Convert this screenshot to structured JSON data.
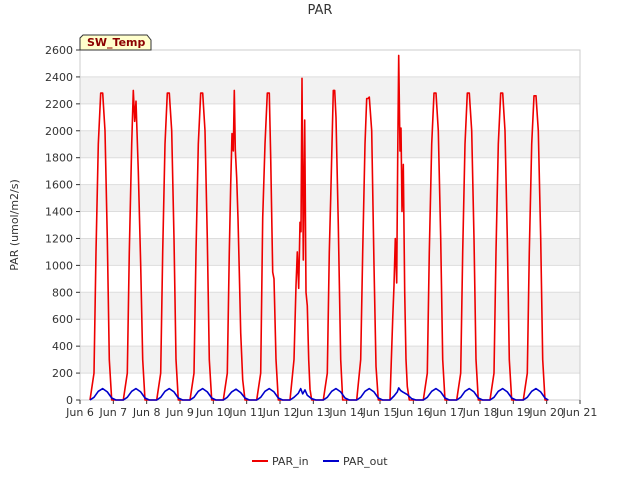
{
  "chart_data": {
    "type": "line",
    "title": "PAR",
    "ylabel": "PAR (umol/m2/s)",
    "xlabel": "",
    "xlim": [
      6,
      21
    ],
    "ylim": [
      0,
      2600
    ],
    "x_ticks": [
      "Jun 6",
      "Jun 7",
      "Jun 8",
      "Jun 9",
      "Jun 10",
      "Jun 11",
      "Jun 12",
      "Jun 13",
      "Jun 14",
      "Jun 15",
      "Jun 16",
      "Jun 17",
      "Jun 18",
      "Jun 19",
      "Jun 20",
      "Jun 21"
    ],
    "y_ticks": [
      0,
      200,
      400,
      600,
      800,
      1000,
      1200,
      1400,
      1600,
      1800,
      2000,
      2200,
      2400,
      2600
    ],
    "grid": true,
    "legend_position": "bottom-center",
    "badge": "SW_Temp",
    "series": [
      {
        "name": "PAR_in",
        "color": "#ee0000",
        "x": [
          6.3,
          6.42,
          6.48,
          6.55,
          6.62,
          6.68,
          6.75,
          6.82,
          6.88,
          6.95,
          7.0,
          7.08,
          7.3,
          7.42,
          7.48,
          7.55,
          7.6,
          7.64,
          7.68,
          7.75,
          7.82,
          7.88,
          7.95,
          8.0,
          8.08,
          8.3,
          8.42,
          8.48,
          8.55,
          8.62,
          8.68,
          8.75,
          8.82,
          8.88,
          8.95,
          9.0,
          9.08,
          9.3,
          9.42,
          9.48,
          9.55,
          9.62,
          9.68,
          9.75,
          9.82,
          9.88,
          9.95,
          10.0,
          10.08,
          10.3,
          10.42,
          10.48,
          10.52,
          10.56,
          10.6,
          10.63,
          10.66,
          10.7,
          10.74,
          10.78,
          10.82,
          10.88,
          10.95,
          11.0,
          11.08,
          11.3,
          11.42,
          11.48,
          11.55,
          11.62,
          11.68,
          11.72,
          11.78,
          11.82,
          11.88,
          11.95,
          12.0,
          12.08,
          12.3,
          12.42,
          12.48,
          12.52,
          12.56,
          12.6,
          12.63,
          12.66,
          12.7,
          12.74,
          12.78,
          12.82,
          12.86,
          12.9,
          12.95,
          13.0,
          13.08,
          13.3,
          13.42,
          13.48,
          13.52,
          13.56,
          13.6,
          13.64,
          13.68,
          13.75,
          13.82,
          13.88,
          13.95,
          14.0,
          14.08,
          14.3,
          14.42,
          14.48,
          14.55,
          14.6,
          14.64,
          14.68,
          14.75,
          14.82,
          14.88,
          14.95,
          15.0,
          15.08,
          15.3,
          15.38,
          15.42,
          15.46,
          15.5,
          15.53,
          15.56,
          15.6,
          15.63,
          15.66,
          15.7,
          15.74,
          15.78,
          15.82,
          15.88,
          15.95,
          16.0,
          16.08,
          16.3,
          16.42,
          16.48,
          16.55,
          16.62,
          16.68,
          16.75,
          16.82,
          16.88,
          16.95,
          17.0,
          17.08,
          17.3,
          17.42,
          17.48,
          17.55,
          17.62,
          17.68,
          17.75,
          17.82,
          17.88,
          17.95,
          18.0,
          18.08,
          18.3,
          18.42,
          18.48,
          18.55,
          18.62,
          18.68,
          18.75,
          18.82,
          18.88,
          18.95,
          19.0,
          19.08,
          19.3,
          19.42,
          19.48,
          19.55,
          19.62,
          19.68,
          19.75,
          19.82,
          19.88,
          19.95,
          20.0,
          20.05
        ],
        "y": [
          0,
          200,
          1100,
          1900,
          2280,
          2280,
          2000,
          1200,
          300,
          0,
          0,
          0,
          0,
          200,
          1100,
          1900,
          2300,
          2070,
          2220,
          1700,
          1000,
          300,
          0,
          0,
          0,
          0,
          200,
          1100,
          1900,
          2280,
          2280,
          2000,
          1200,
          300,
          0,
          0,
          0,
          0,
          200,
          1100,
          1900,
          2280,
          2280,
          2000,
          1200,
          300,
          0,
          0,
          0,
          0,
          200,
          1100,
          1600,
          1980,
          1850,
          2300,
          1860,
          1650,
          1350,
          950,
          500,
          150,
          0,
          0,
          0,
          0,
          200,
          1350,
          1900,
          2280,
          2280,
          1800,
          950,
          900,
          300,
          0,
          0,
          0,
          0,
          300,
          850,
          1100,
          830,
          1320,
          1250,
          2390,
          1040,
          2080,
          800,
          700,
          300,
          80,
          0,
          0,
          0,
          0,
          200,
          1100,
          1500,
          1900,
          2300,
          2300,
          2100,
          1300,
          300,
          0,
          0,
          0,
          0,
          0,
          300,
          1100,
          1900,
          2240,
          2240,
          2250,
          2000,
          1000,
          250,
          0,
          0,
          0,
          0,
          600,
          850,
          1200,
          870,
          1800,
          2560,
          1850,
          2020,
          1400,
          1750,
          800,
          300,
          100,
          0,
          0,
          0,
          0,
          0,
          200,
          1100,
          1900,
          2280,
          2280,
          2000,
          1200,
          300,
          0,
          0,
          0,
          0,
          200,
          1100,
          1900,
          2280,
          2280,
          2000,
          1200,
          300,
          0,
          0,
          0,
          0,
          200,
          1100,
          1900,
          2280,
          2280,
          2000,
          1200,
          300,
          0,
          0,
          0,
          0,
          200,
          1100,
          1900,
          2260,
          2260,
          2000,
          1200,
          300,
          0,
          0,
          0
        ]
      },
      {
        "name": "PAR_out",
        "color": "#0000cc",
        "x": [
          6.3,
          6.42,
          6.55,
          6.68,
          6.82,
          6.95,
          7.08,
          7.3,
          7.42,
          7.55,
          7.68,
          7.82,
          7.95,
          8.08,
          8.3,
          8.42,
          8.55,
          8.68,
          8.82,
          8.95,
          9.08,
          9.3,
          9.42,
          9.55,
          9.68,
          9.82,
          9.95,
          10.08,
          10.3,
          10.42,
          10.55,
          10.68,
          10.82,
          10.95,
          11.08,
          11.3,
          11.42,
          11.55,
          11.68,
          11.82,
          11.95,
          12.08,
          12.3,
          12.42,
          12.55,
          12.62,
          12.68,
          12.75,
          12.82,
          12.95,
          13.08,
          13.3,
          13.42,
          13.55,
          13.68,
          13.82,
          13.95,
          14.08,
          14.3,
          14.42,
          14.55,
          14.68,
          14.82,
          14.95,
          15.08,
          15.3,
          15.42,
          15.52,
          15.56,
          15.62,
          15.68,
          15.82,
          15.95,
          16.08,
          16.3,
          16.42,
          16.55,
          16.68,
          16.82,
          16.95,
          17.08,
          17.3,
          17.42,
          17.55,
          17.68,
          17.82,
          17.95,
          18.08,
          18.3,
          18.42,
          18.55,
          18.68,
          18.82,
          18.95,
          19.08,
          19.3,
          19.42,
          19.55,
          19.68,
          19.82,
          19.95,
          20.05
        ],
        "y": [
          0,
          20,
          65,
          85,
          60,
          15,
          0,
          0,
          20,
          65,
          85,
          60,
          15,
          0,
          0,
          20,
          65,
          85,
          60,
          15,
          0,
          0,
          20,
          65,
          85,
          60,
          15,
          0,
          0,
          20,
          60,
          80,
          55,
          15,
          0,
          0,
          20,
          65,
          85,
          60,
          15,
          0,
          0,
          20,
          50,
          85,
          45,
          75,
          35,
          10,
          0,
          0,
          20,
          65,
          85,
          60,
          15,
          0,
          0,
          20,
          65,
          85,
          60,
          15,
          0,
          0,
          30,
          60,
          90,
          70,
          60,
          40,
          10,
          0,
          0,
          20,
          65,
          85,
          60,
          15,
          0,
          0,
          20,
          65,
          85,
          60,
          15,
          0,
          0,
          20,
          65,
          85,
          60,
          15,
          0,
          0,
          20,
          65,
          85,
          60,
          15,
          0
        ]
      }
    ]
  }
}
